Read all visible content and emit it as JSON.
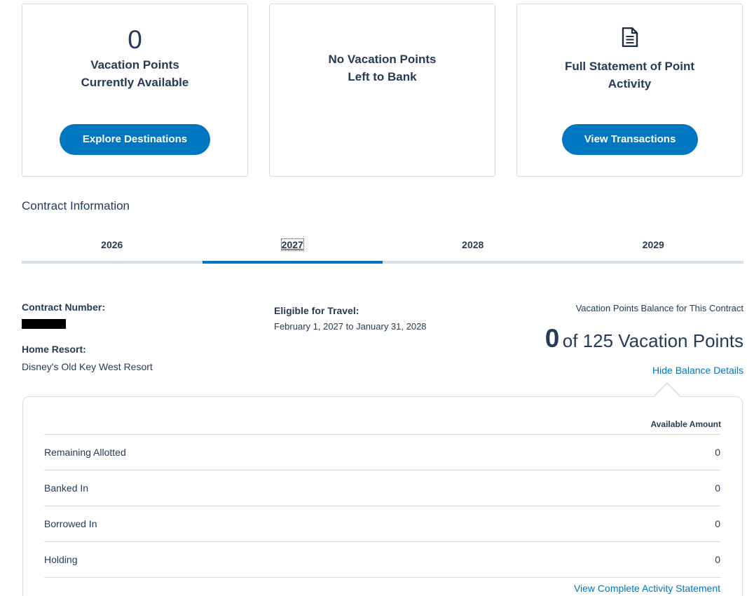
{
  "cards": {
    "points": {
      "number": "0",
      "title": "Vacation Points\nCurrently Available",
      "button": "Explore Destinations"
    },
    "bank": {
      "title": "No Vacation Points\nLeft to Bank"
    },
    "statement": {
      "icon": "document-icon",
      "title": "Full Statement of Point Activity",
      "button": "View Transactions"
    }
  },
  "contract": {
    "section_title": "Contract Information",
    "tabs": [
      "2026",
      "2027",
      "2028",
      "2029"
    ],
    "active_tab": "2027",
    "number_label": "Contract Number:",
    "home_resort_label": "Home Resort:",
    "home_resort": "Disney's Old Key West Resort",
    "eligible_label": "Eligible for Travel:",
    "eligible_dates": "February 1, 2027 to January 31, 2028",
    "balance_label": "Vacation Points Balance for This Contract",
    "balance_current": "0",
    "balance_total_text": "of 125 Vacation Points",
    "hide_link": "Hide Balance Details"
  },
  "balance_table": {
    "header": "Available Amount",
    "rows": [
      {
        "label": "Remaining Allotted",
        "value": "0"
      },
      {
        "label": "Banked In",
        "value": "0"
      },
      {
        "label": "Borrowed In",
        "value": "0"
      },
      {
        "label": "Holding",
        "value": "0"
      }
    ],
    "activity_link": "View Complete Activity Statement"
  }
}
